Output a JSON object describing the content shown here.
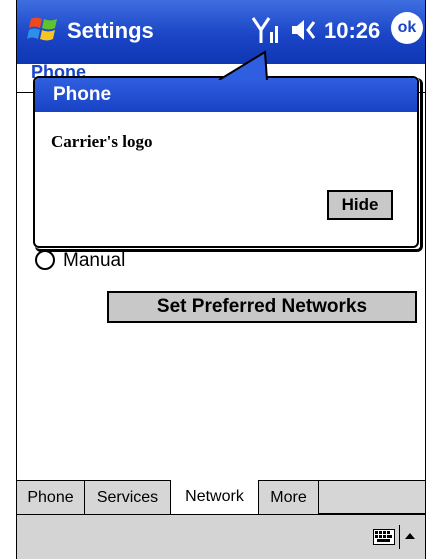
{
  "titlebar": {
    "title": "Settings",
    "time": "10:26",
    "ok_label": "ok",
    "icons": [
      "windows-start-icon",
      "signal-icon",
      "volume-icon"
    ]
  },
  "page": {
    "header": "Phone"
  },
  "bubble": {
    "title": "Phone",
    "message": "Carrier's logo",
    "hide_label": "Hide"
  },
  "network": {
    "radio_manual": "Manual",
    "preferred_button": "Set Preferred Networks"
  },
  "tabs": [
    {
      "label": "Phone",
      "active": false
    },
    {
      "label": "Services",
      "active": false
    },
    {
      "label": "Network",
      "active": true
    },
    {
      "label": "More",
      "active": false
    }
  ],
  "menubar": {
    "icons": [
      "keyboard-icon",
      "up-arrow-icon"
    ]
  },
  "colors": {
    "titlebar": "#1a45c6",
    "button_face": "#c8c8c8",
    "header_text": "#1a45c6"
  }
}
